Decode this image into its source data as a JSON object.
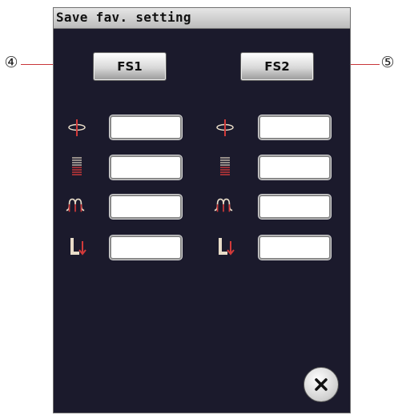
{
  "window": {
    "title": "Save fav. setting"
  },
  "buttons": {
    "fs1": "FS1",
    "fs2": "FS2"
  },
  "callouts": {
    "left": "④",
    "right": "⑤"
  },
  "settings_rows": [
    {
      "icon": "needle-position-icon"
    },
    {
      "icon": "stitch-length-icon"
    },
    {
      "icon": "thread-tension-icon"
    },
    {
      "icon": "presser-foot-icon"
    }
  ],
  "colors": {
    "accent": "#c8363a",
    "panel": "#1b1a2c"
  }
}
